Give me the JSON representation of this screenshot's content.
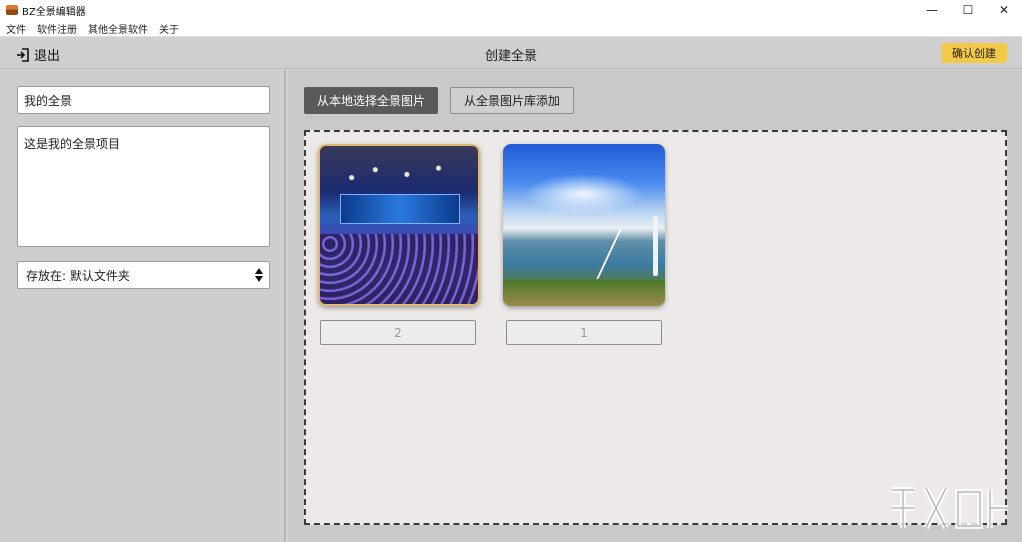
{
  "window": {
    "title": "BZ全景编辑器",
    "controls": {
      "minimize": "—",
      "maximize": "☐",
      "close": "✕"
    }
  },
  "menu": {
    "items": [
      {
        "label": "文件"
      },
      {
        "label": "软件注册"
      },
      {
        "label": "其他全景软件"
      },
      {
        "label": "关于"
      }
    ]
  },
  "header": {
    "exit_label": "退出",
    "title": "创建全景",
    "confirm_label": "确认创建",
    "confirm_color": "#f3c94a"
  },
  "form": {
    "name_value": "我的全景",
    "description_value": "这是我的全景项目",
    "save_location_value": "存放在: 默认文件夹"
  },
  "tabs": {
    "local_label": "从本地选择全景图片",
    "library_label": "从全景图片库添加"
  },
  "panoramas": [
    {
      "icon": "concert-hall-panorama-image",
      "order": "2",
      "selected": true
    },
    {
      "icon": "bridge-lake-panorama-image",
      "order": "1",
      "selected": false
    }
  ]
}
